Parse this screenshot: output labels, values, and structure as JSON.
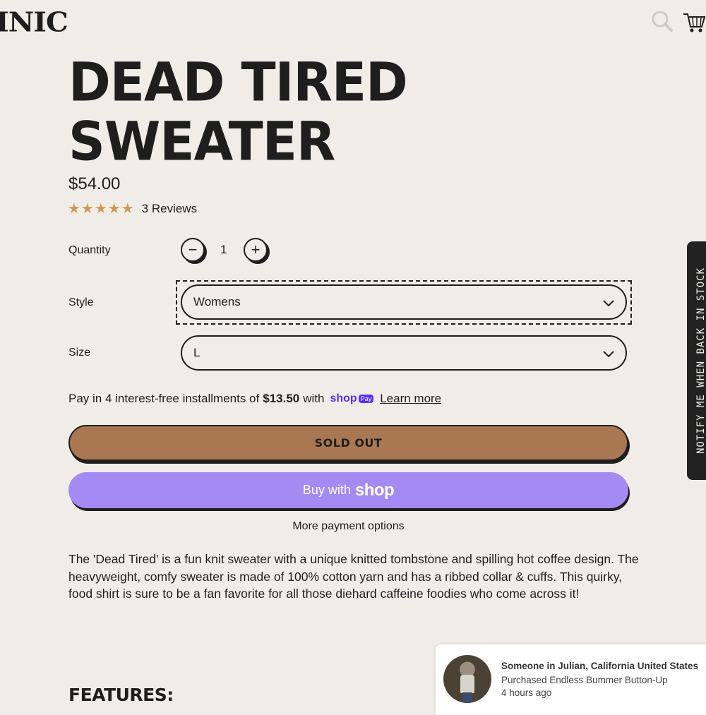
{
  "header": {
    "logo_text": "INIC",
    "icons": [
      "search-icon",
      "cart-icon"
    ]
  },
  "product": {
    "title_line1": "DEAD TIRED",
    "title_line2": "SWEATER",
    "price": "$54.00",
    "rating": 5,
    "stars": "★★★★★",
    "reviews_label": "3 Reviews"
  },
  "options": {
    "quantity_label": "Quantity",
    "quantity_minus": "−",
    "quantity_value": "1",
    "quantity_plus": "+",
    "style_label": "Style",
    "style_value": "Womens",
    "size_label": "Size",
    "size_value": "L"
  },
  "payment": {
    "installments_prefix": "Pay in 4 interest-free installments of",
    "installments_amount": "$13.50",
    "installments_with": "with",
    "shop_word": "shop",
    "shop_pill": "Pay",
    "learn_more": "Learn more",
    "sold_out_label": "SOLD OUT",
    "buy_with_label": "Buy with",
    "buy_shop_logo": "shop",
    "more_options": "More payment options"
  },
  "description": "The 'Dead Tired' is a fun knit sweater with a unique knitted tombstone and spilling hot coffee design.  The heavyweight, comfy sweater is made of 100% cotton yarn and has a ribbed collar & cuffs. This quirky, food shirt is sure to be a fan favorite for all those diehard caffeine foodies who come across it!",
  "features_heading": "FEATURES:",
  "notify_tab_label": "NOTIFY ME WHEN BACK IN STOCK",
  "toast": {
    "title": "Someone in Julian, California United States",
    "subtitle": "Purchased Endless Bummer Button-Up",
    "time": "4 hours ago"
  },
  "colors": {
    "background": "#f0ede8",
    "text": "#1e1e1e",
    "stars": "#cc9a53",
    "sold_out": "#a97853",
    "shop_purple": "#a58af3",
    "shop_brand": "#5a31f4"
  }
}
